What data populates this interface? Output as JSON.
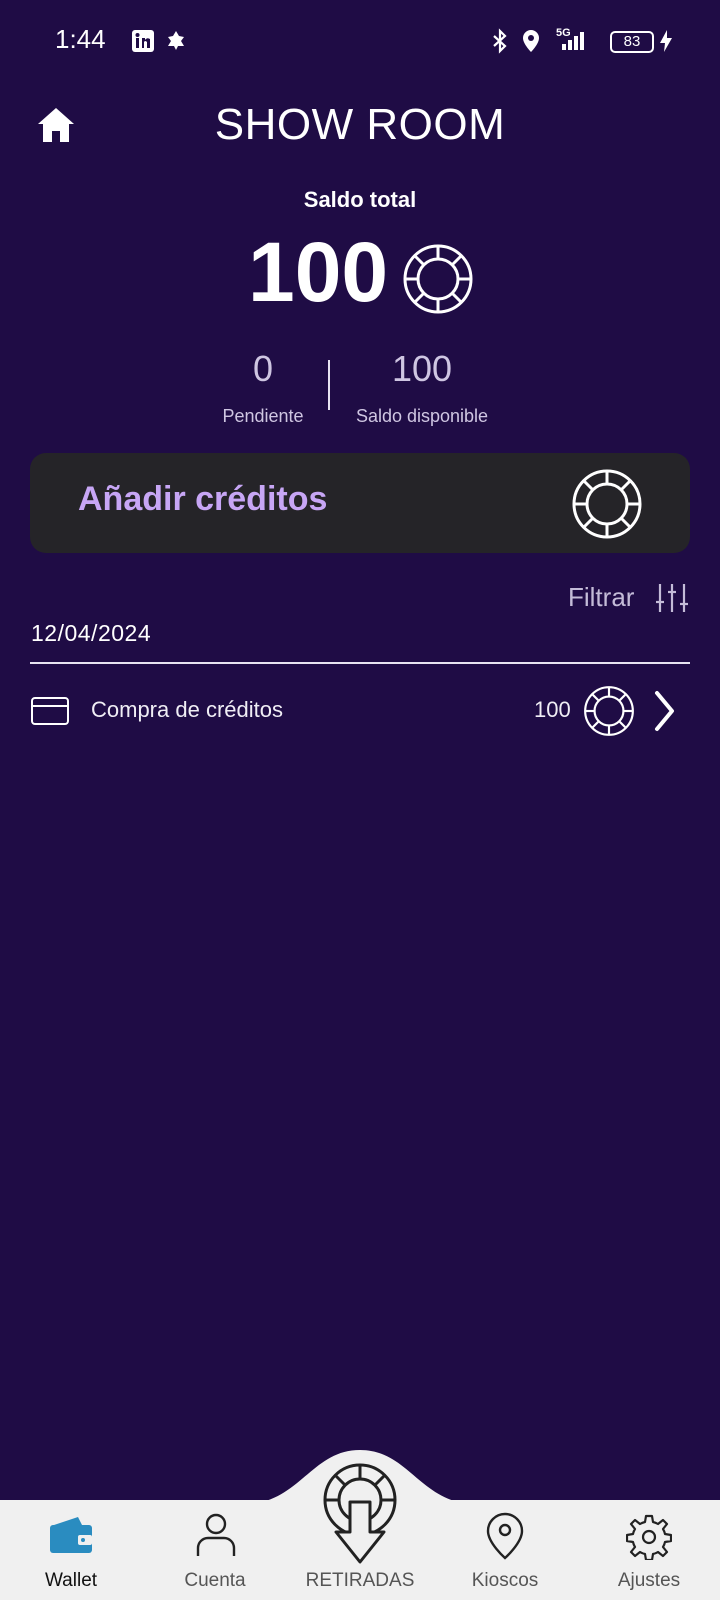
{
  "status_bar": {
    "time": "1:44",
    "battery": "83",
    "network": "5G"
  },
  "header": {
    "title": "SHOW ROOM"
  },
  "balance": {
    "label": "Saldo total",
    "total": "100",
    "pending_value": "0",
    "pending_label": "Pendiente",
    "available_value": "100",
    "available_label": "Saldo disponible"
  },
  "add_credits": {
    "label": "Añadir créditos"
  },
  "filter": {
    "label": "Filtrar"
  },
  "transactions": {
    "date": "12/04/2024",
    "items": [
      {
        "label": "Compra de créditos",
        "amount": "100"
      }
    ]
  },
  "nav": {
    "items": [
      {
        "label": "Wallet",
        "icon": "wallet-icon",
        "active": true
      },
      {
        "label": "Cuenta",
        "icon": "person-icon"
      },
      {
        "label": "RETIRADAS",
        "icon": "withdraw-chip-icon"
      },
      {
        "label": "Kioscos",
        "icon": "location-pin-icon"
      },
      {
        "label": "Ajustes",
        "icon": "gear-icon"
      }
    ]
  },
  "colors": {
    "background": "#1f0c45",
    "accent": "#c7a6f5",
    "card": "#252428",
    "nav_active": "#2a8cc0"
  }
}
